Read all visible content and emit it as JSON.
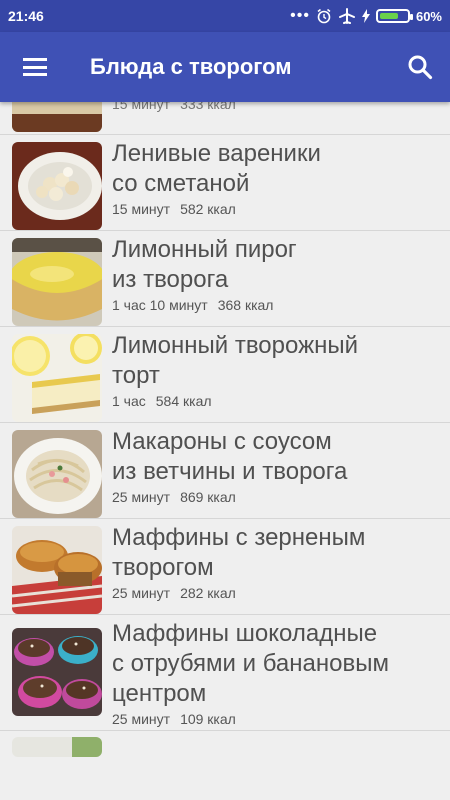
{
  "status_bar": {
    "time": "21:46",
    "battery": "60%"
  },
  "app_bar": {
    "title": "Блюда с творогом"
  },
  "recipes": [
    {
      "title": "",
      "time": "15 минут",
      "kcal": "333 ккал"
    },
    {
      "title": "Ленивые вареники\nсо сметаной",
      "time": "15 минут",
      "kcal": "582 ккал"
    },
    {
      "title": "Лимонный пирог\nиз творога",
      "time": "1 час 10 минут",
      "kcal": "368 ккал"
    },
    {
      "title": "Лимонный творожный\nторт",
      "time": "1 час",
      "kcal": "584 ккал"
    },
    {
      "title": "Макароны с соусом\nиз ветчины и творога",
      "time": "25 минут",
      "kcal": "869 ккал"
    },
    {
      "title": "Маффины с зерненым\nтворогом",
      "time": "25 минут",
      "kcal": "282 ккал"
    },
    {
      "title": "Маффины шоколадные\nс отрубями и банановым\nцентром",
      "time": "25 минут",
      "kcal": "109 ккал"
    }
  ]
}
